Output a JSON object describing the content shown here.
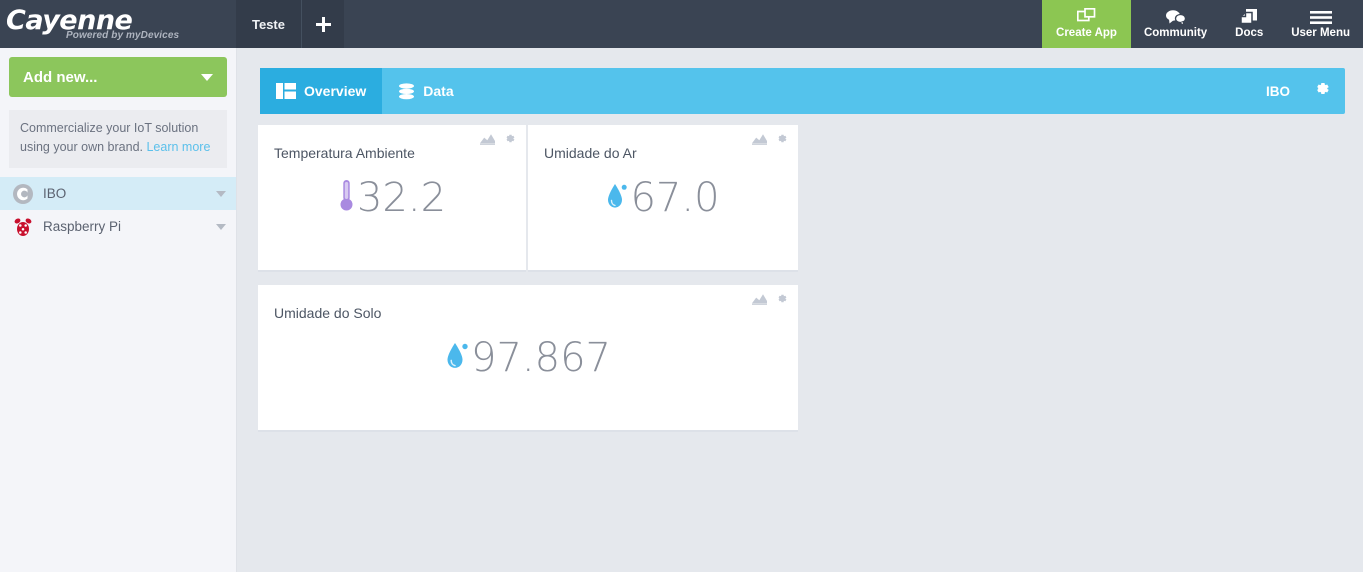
{
  "brand": {
    "name": "Cayenne",
    "tagline": "Powered by myDevices"
  },
  "dashboard_tabs": [
    {
      "label": "Teste"
    }
  ],
  "add_tab_label": "+",
  "topnav": [
    {
      "label": "Create App",
      "icon": "create-app-icon",
      "accent": "#8cc652"
    },
    {
      "label": "Community",
      "icon": "community-icon"
    },
    {
      "label": "Docs",
      "icon": "docs-icon"
    },
    {
      "label": "User Menu",
      "icon": "hamburger-icon"
    }
  ],
  "sidebar": {
    "add_new_label": "Add new...",
    "promo": {
      "text": "Commercialize your IoT solution using your own brand. ",
      "link_label": "Learn more"
    },
    "devices": [
      {
        "label": "IBO",
        "icon": "cayenne-circle-icon",
        "active": true
      },
      {
        "label": "Raspberry Pi",
        "icon": "raspberry-pi-icon",
        "active": false
      }
    ]
  },
  "content_tabs": [
    {
      "label": "Overview",
      "icon": "overview-grid-icon",
      "active": true
    },
    {
      "label": "Data",
      "icon": "database-icon",
      "active": false
    }
  ],
  "project_name": "IBO",
  "settings_icon": "gear-icon",
  "widgets": [
    {
      "title": "Temperatura Ambiente",
      "value": "32.2",
      "icon": "thermometer-icon",
      "icon_color": "#a98ae0",
      "chart_icon": "chart-icon",
      "gear_icon": "gear-icon"
    },
    {
      "title": "Umidade do Ar",
      "value": "67.0",
      "icon": "water-drop-icon",
      "icon_color": "#4bb8ec",
      "chart_icon": "chart-icon",
      "gear_icon": "gear-icon"
    },
    {
      "title": "Umidade do Solo",
      "value": "97.867",
      "icon": "water-drop-icon",
      "icon_color": "#4bb8ec",
      "chart_icon": "chart-icon",
      "gear_icon": "gear-icon"
    }
  ],
  "colors": {
    "topbar": "#3a4453",
    "accent_green": "#8cc652",
    "accent_blue": "#54c3ec",
    "tab_active_blue": "#2bade0",
    "sidebar_bg": "#f4f5f9",
    "content_bg": "#e5e8ed"
  }
}
